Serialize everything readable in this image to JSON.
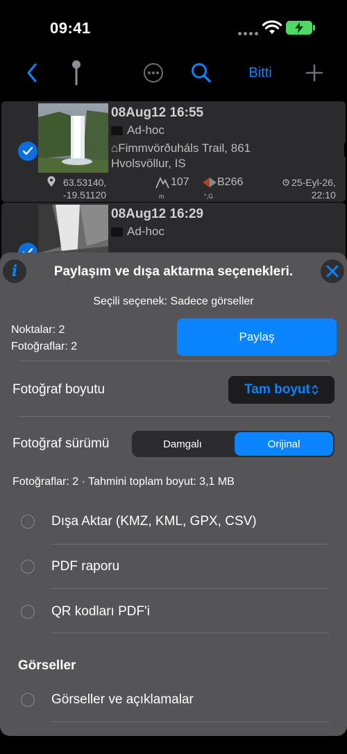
{
  "status_bar": {
    "time": "09:41"
  },
  "toolbar": {
    "done_label": "Bitti"
  },
  "rows": [
    {
      "date": "08Aug12 16:55",
      "folder": "Ad-hoc",
      "address_line1": "⌂Fimmvörðuháls Trail, 861",
      "address_line2": "Hvolsvöllur, IS",
      "lat": "63.53140,",
      "lon": "-19.51120",
      "altitude": "107",
      "altitude_unit": "m",
      "bearing": "B266",
      "bearing_unit": "°,G",
      "timestamp_line1": "25-Eyl-26,",
      "timestamp_line2": "22:10"
    },
    {
      "date": "08Aug12 16:29",
      "folder": "Ad-hoc"
    }
  ],
  "sheet": {
    "title": "Paylaşım ve dışa aktarma seçenekleri.",
    "selected_option": "Seçili seçenek: Sadece görseller",
    "points_count": "Noktalar: 2",
    "photos_count": "Fotoğraflar: 2",
    "share_label": "Paylaş",
    "photo_size_label": "Fotoğraf boyutu",
    "photo_size_value": "Tam boyut",
    "photo_version_label": "Fotoğraf sürümü",
    "version_options": [
      "Damgalı",
      "Orijinal"
    ],
    "selected_version": "Orijinal",
    "estimate": "Fotoğraflar: 2 · Tahmini toplam boyut: 3,1 MB",
    "options": [
      "Dışa Aktar (KMZ, KML, GPX, CSV)",
      "PDF raporu",
      "QR kodları PDF'i"
    ],
    "images_section": "Görseller",
    "images_option": "Görseller ve açıklamalar"
  },
  "colors": {
    "accent": "#0a84ff",
    "sheet_bg": "#555557",
    "row_bg": "#2b2b2d",
    "battery": "#4cd964"
  }
}
